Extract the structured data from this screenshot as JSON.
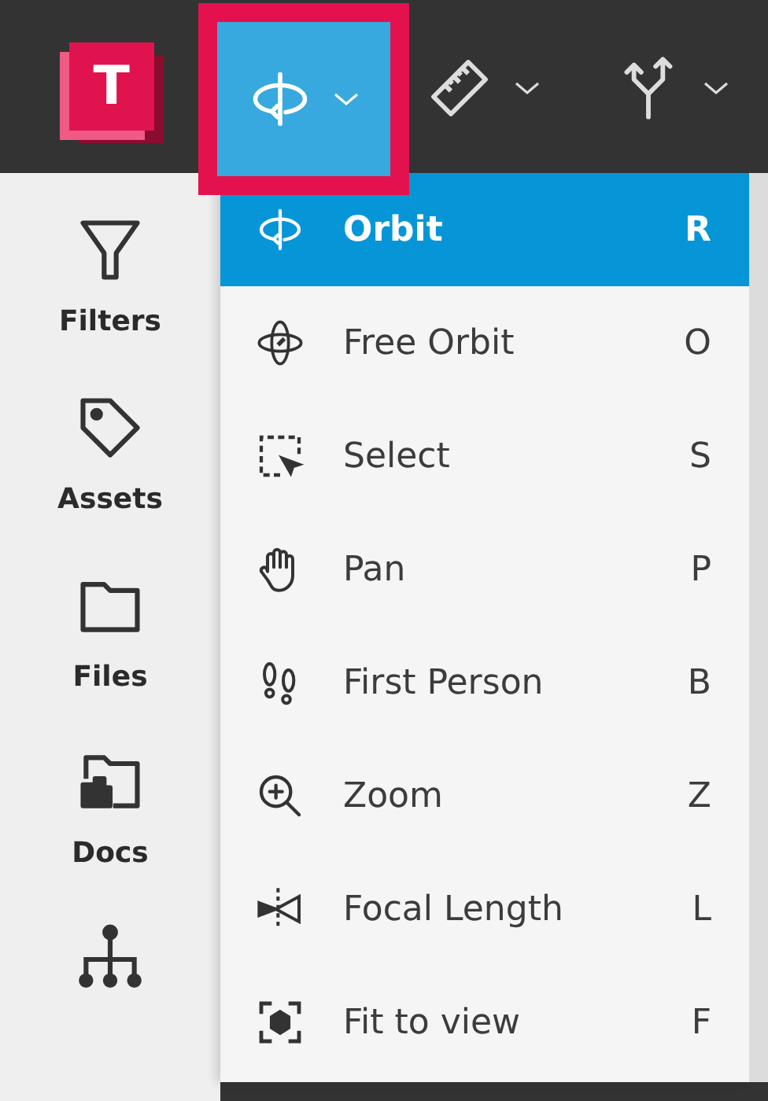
{
  "logo": {
    "letter": "T"
  },
  "toolbar": [
    {
      "kind": "orbit",
      "selected": true,
      "highlighted": true
    },
    {
      "kind": "measure",
      "selected": false,
      "highlighted": false
    },
    {
      "kind": "explode",
      "selected": false,
      "highlighted": false
    }
  ],
  "sidebar": {
    "items": [
      {
        "kind": "filter",
        "label": "Filters"
      },
      {
        "kind": "tag",
        "label": "Assets"
      },
      {
        "kind": "folder",
        "label": "Files"
      },
      {
        "kind": "docs",
        "label": "Docs"
      },
      {
        "kind": "tree"
      }
    ]
  },
  "menu": {
    "items": [
      {
        "kind": "orbit",
        "label": "Orbit",
        "shortcut": "R",
        "selected": true
      },
      {
        "kind": "free-orbit",
        "label": "Free Orbit",
        "shortcut": "O",
        "selected": false
      },
      {
        "kind": "select",
        "label": "Select",
        "shortcut": "S",
        "selected": false
      },
      {
        "kind": "pan",
        "label": "Pan",
        "shortcut": "P",
        "selected": false
      },
      {
        "kind": "first-person",
        "label": "First Person",
        "shortcut": "B",
        "selected": false
      },
      {
        "kind": "zoom",
        "label": "Zoom",
        "shortcut": "Z",
        "selected": false
      },
      {
        "kind": "focal",
        "label": "Focal Length",
        "shortcut": "L",
        "selected": false
      },
      {
        "kind": "fit",
        "label": "Fit to view",
        "shortcut": "F",
        "selected": false
      }
    ]
  }
}
